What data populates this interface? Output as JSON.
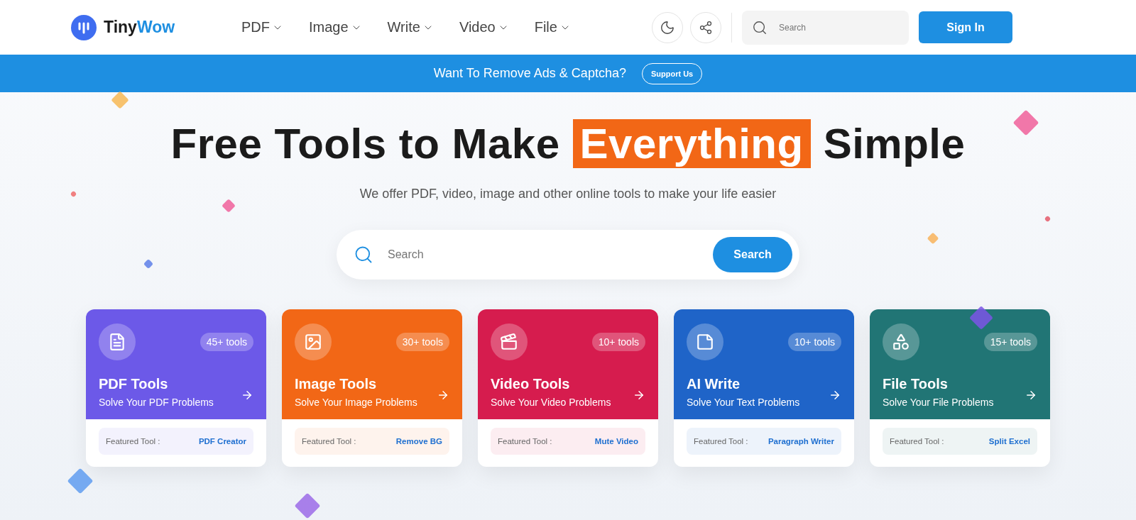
{
  "header": {
    "logo_text": "Tiny",
    "logo_accent": "Wow",
    "nav": [
      {
        "label": "PDF"
      },
      {
        "label": "Image"
      },
      {
        "label": "Write"
      },
      {
        "label": "Video"
      },
      {
        "label": "File"
      }
    ],
    "search": {
      "placeholder": "Search"
    },
    "sign_in": "Sign In"
  },
  "banner": {
    "text": "Want To Remove Ads & Captcha?",
    "button": "Support Us"
  },
  "hero": {
    "headline_before": "Free Tools to Make",
    "headline_highlight": "Everything",
    "headline_after": "Simple",
    "subtitle": "We offer PDF, video, image and other online tools to make your life easier",
    "search": {
      "placeholder": "Search",
      "button": "Search"
    }
  },
  "cards": [
    {
      "kind": "pdf",
      "color": "#6c59e8",
      "count": "45+ tools",
      "title": "PDF Tools",
      "subtitle": "Solve Your PDF Problems",
      "featured_label": "Featured Tool :",
      "featured_tool": "PDF Creator"
    },
    {
      "kind": "image",
      "color": "#f26716",
      "count": "30+ tools",
      "title": "Image Tools",
      "subtitle": "Solve Your Image Problems",
      "featured_label": "Featured Tool :",
      "featured_tool": "Remove BG"
    },
    {
      "kind": "video",
      "color": "#d61c4e",
      "count": "10+ tools",
      "title": "Video Tools",
      "subtitle": "Solve Your Video Problems",
      "featured_label": "Featured Tool :",
      "featured_tool": "Mute Video"
    },
    {
      "kind": "write",
      "color": "#1f64c8",
      "count": "10+ tools",
      "title": "AI Write",
      "subtitle": "Solve Your Text Problems",
      "featured_label": "Featured Tool :",
      "featured_tool": "Paragraph Writer"
    },
    {
      "kind": "file",
      "color": "#217575",
      "count": "15+ tools",
      "title": "File Tools",
      "subtitle": "Solve Your File Problems",
      "featured_label": "Featured Tool :",
      "featured_tool": "Split Excel"
    }
  ]
}
